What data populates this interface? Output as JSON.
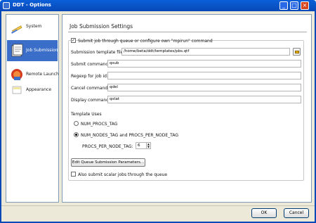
{
  "window": {
    "title": "DDT - Options",
    "minimize": "_",
    "maximize": "□",
    "close": "×"
  },
  "sidebar": {
    "items": [
      {
        "label": "System",
        "icon": "pencil-icon"
      },
      {
        "label": "Job Submission",
        "icon": "job-card-icon"
      },
      {
        "label": "Remote Launch",
        "icon": "remote-launch-icon"
      },
      {
        "label": "Appearance",
        "icon": "appearance-icon"
      }
    ],
    "active_index": 1
  },
  "main": {
    "section_title": "Job Submission Settings",
    "submit_through_queue": {
      "label": "Submit job through queue or configure own \"mpirun\" command",
      "checked": true
    },
    "fields": {
      "template_file": {
        "label": "Submission template file:",
        "value": "/home/beta/ddt/templates/pbs.qtf"
      },
      "submit_command": {
        "label": "Submit command:",
        "value": "qsub"
      },
      "regexp": {
        "label": "Regexp for job id:",
        "value": ""
      },
      "cancel_command": {
        "label": "Cancel command:",
        "value": "qdel"
      },
      "display_command": {
        "label": "Display command:",
        "value": "qstat"
      }
    },
    "template_uses": {
      "label": "Template Uses",
      "options": [
        {
          "label": "NUM_PROCS_TAG",
          "selected": false
        },
        {
          "label": "NUM_NODES_TAG and PROCS_PER_NODE_TAG",
          "selected": true
        }
      ],
      "procs_per_node": {
        "label": "PROCS_PER_NODE_TAG:",
        "value": "6"
      }
    },
    "edit_params_button": "Edit Queue Submission Parameters...",
    "also_submit_scalar": {
      "label": "Also submit scalar jobs through the queue",
      "checked": false
    }
  },
  "buttons": {
    "ok": "OK",
    "cancel": "Cancel"
  },
  "colors": {
    "titlebar": "#0849b8",
    "selection": "#3b6ec8",
    "close": "#d8461f"
  }
}
